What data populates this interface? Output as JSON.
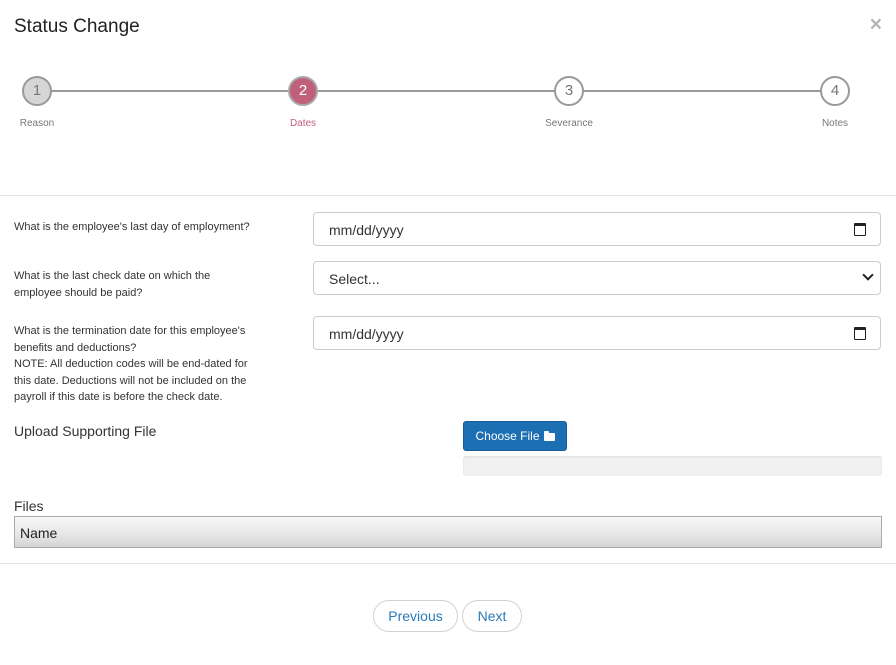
{
  "modal": {
    "title": "Status Change",
    "close_glyph": "×"
  },
  "stepper": {
    "current_step": 2,
    "steps": [
      {
        "number": "1",
        "label": "Reason",
        "state": "completed"
      },
      {
        "number": "2",
        "label": "Dates",
        "state": "active"
      },
      {
        "number": "3",
        "label": "Severance",
        "state": "pending"
      },
      {
        "number": "4",
        "label": "Notes",
        "state": "pending"
      }
    ]
  },
  "form": {
    "last_day": {
      "question": "What is the employee's last day of employment?",
      "value": "mm/dd/yyyy"
    },
    "last_check": {
      "question_line1": "What is the last check date on which the",
      "question_line2": "employee should be paid?",
      "value": "Select..."
    },
    "termination": {
      "question_line1": "What is the termination date for this employee's",
      "question_line2": "benefits and deductions?",
      "note_line1": "NOTE: All deduction codes will be end-dated for",
      "note_line2": "this date. Deductions will not be included on the",
      "note_line3": "payroll if this date is before the check date.",
      "value": "mm/dd/yyyy"
    }
  },
  "upload": {
    "label": "Upload Supporting File",
    "button_label": "Choose File",
    "progress_percent": 0
  },
  "files": {
    "label": "Files",
    "columns": [
      "Name"
    ]
  },
  "footer": {
    "previous_label": "Previous",
    "next_label": "Next"
  },
  "colors": {
    "accent_active_step": "#c0607a",
    "primary_button": "#1c6fb3",
    "link_text": "#2a7ab8"
  },
  "icons": {
    "close": "close-icon",
    "calendar": "calendar-icon",
    "dropdown": "chevron-down-icon",
    "folder": "folder-open-icon"
  }
}
